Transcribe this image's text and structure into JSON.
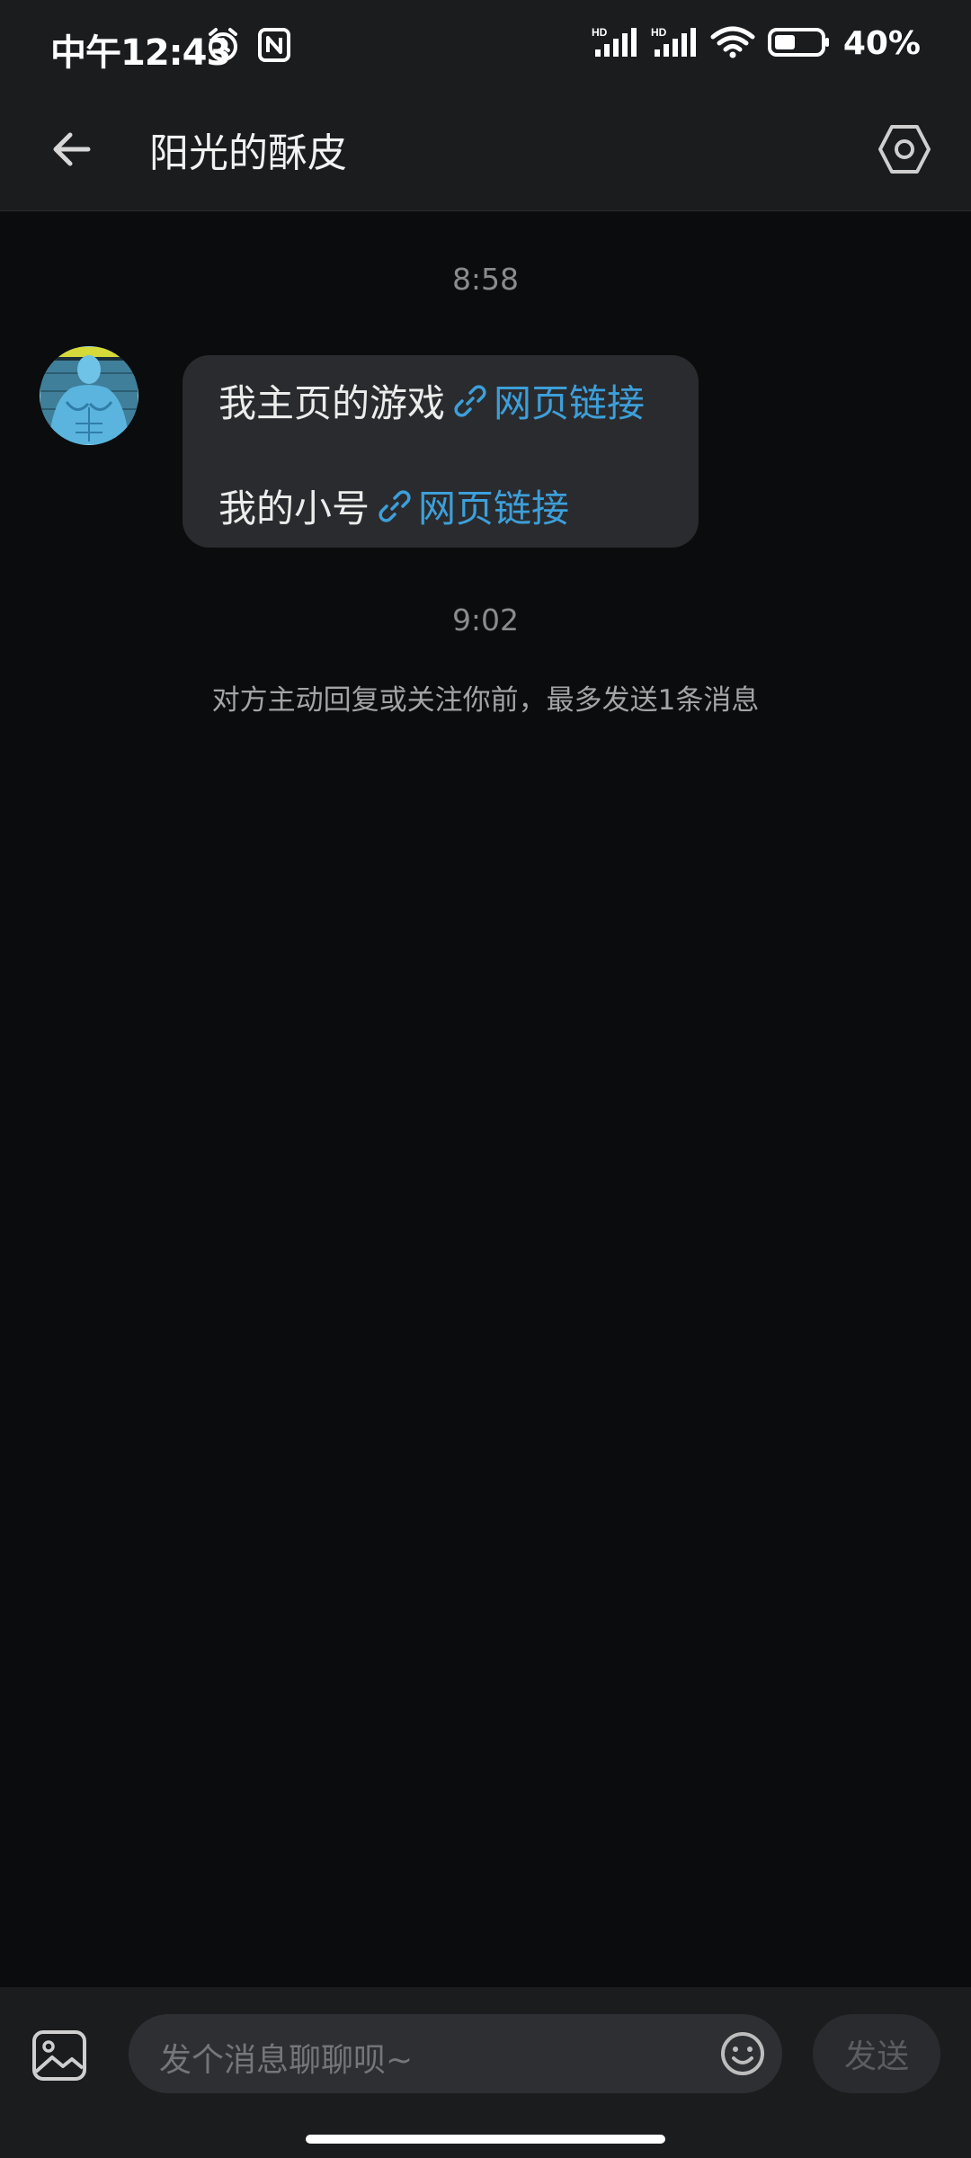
{
  "status_bar": {
    "time": "中午12:43",
    "battery": "40%",
    "icons": [
      "alarm-icon",
      "nfc-icon",
      "signal-hd-icon",
      "signal-hd-icon",
      "wifi-icon",
      "battery-icon"
    ]
  },
  "header": {
    "title": "阳光的酥皮",
    "back_icon": "back-arrow-icon",
    "settings_icon": "settings-hexagon-icon"
  },
  "chat": {
    "messages": [
      {
        "time": "8:58",
        "sender": "other",
        "lines": [
          {
            "text": "我主页的游戏",
            "link_label": "网页链接"
          },
          {
            "text": "我的小号",
            "link_label": "网页链接"
          }
        ]
      }
    ],
    "time_2": "9:02",
    "notice": "对方主动回复或关注你前，最多发送1条消息"
  },
  "input_bar": {
    "placeholder": "发个消息聊聊呗~",
    "send_label": "发送",
    "image_icon": "image-icon",
    "emoji_icon": "emoji-icon"
  },
  "colors": {
    "background": "#0b0c0e",
    "bar": "#1b1c1e",
    "bubble": "#2a2b2e",
    "link": "#3d9fd9"
  }
}
